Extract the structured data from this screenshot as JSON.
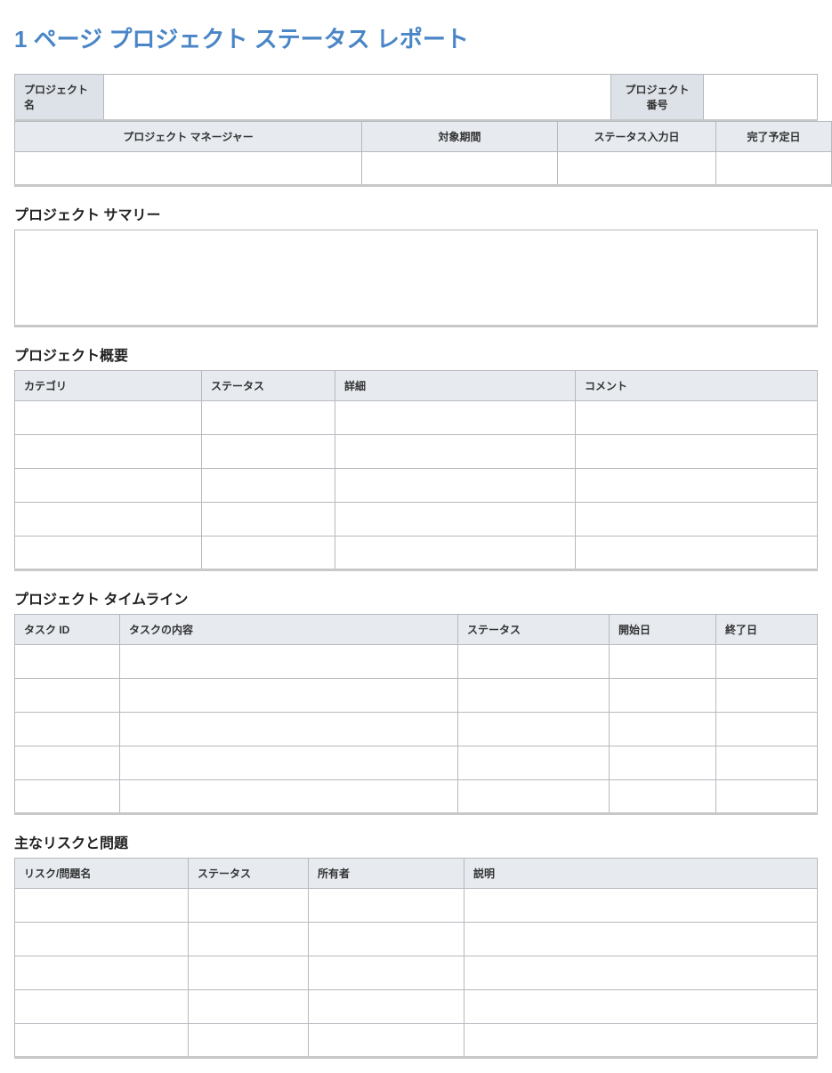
{
  "title": "1 ページ プロジェクト ステータス レポート",
  "header": {
    "project_name_label": "プロジェクト名",
    "project_name_value": "",
    "project_number_label": "プロジェクト番号",
    "project_number_value": "",
    "pm_label": "プロジェクト マネージャー",
    "pm_value": "",
    "period_label": "対象期間",
    "period_value": "",
    "status_date_label": "ステータス入力日",
    "status_date_value": "",
    "due_date_label": "完了予定日",
    "due_date_value": ""
  },
  "summary": {
    "heading": "プロジェクト サマリー",
    "text": ""
  },
  "overview": {
    "heading": "プロジェクト概要",
    "cols": {
      "category": "カテゴリ",
      "status": "ステータス",
      "detail": "詳細",
      "comment": "コメント"
    },
    "rows": [
      {
        "category": "",
        "status": "",
        "detail": "",
        "comment": ""
      },
      {
        "category": "",
        "status": "",
        "detail": "",
        "comment": ""
      },
      {
        "category": "",
        "status": "",
        "detail": "",
        "comment": ""
      },
      {
        "category": "",
        "status": "",
        "detail": "",
        "comment": ""
      },
      {
        "category": "",
        "status": "",
        "detail": "",
        "comment": ""
      }
    ]
  },
  "timeline": {
    "heading": "プロジェクト タイムライン",
    "cols": {
      "task_id": "タスク ID",
      "task_desc": "タスクの内容",
      "status": "ステータス",
      "start": "開始日",
      "end": "終了日"
    },
    "rows": [
      {
        "task_id": "",
        "task_desc": "",
        "status": "",
        "start": "",
        "end": ""
      },
      {
        "task_id": "",
        "task_desc": "",
        "status": "",
        "start": "",
        "end": ""
      },
      {
        "task_id": "",
        "task_desc": "",
        "status": "",
        "start": "",
        "end": ""
      },
      {
        "task_id": "",
        "task_desc": "",
        "status": "",
        "start": "",
        "end": ""
      },
      {
        "task_id": "",
        "task_desc": "",
        "status": "",
        "start": "",
        "end": ""
      }
    ]
  },
  "risks": {
    "heading": "主なリスクと問題",
    "cols": {
      "name": "リスク/問題名",
      "status": "ステータス",
      "owner": "所有者",
      "desc": "説明"
    },
    "rows": [
      {
        "name": "",
        "status": "",
        "owner": "",
        "desc": ""
      },
      {
        "name": "",
        "status": "",
        "owner": "",
        "desc": ""
      },
      {
        "name": "",
        "status": "",
        "owner": "",
        "desc": ""
      },
      {
        "name": "",
        "status": "",
        "owner": "",
        "desc": ""
      },
      {
        "name": "",
        "status": "",
        "owner": "",
        "desc": ""
      }
    ]
  }
}
